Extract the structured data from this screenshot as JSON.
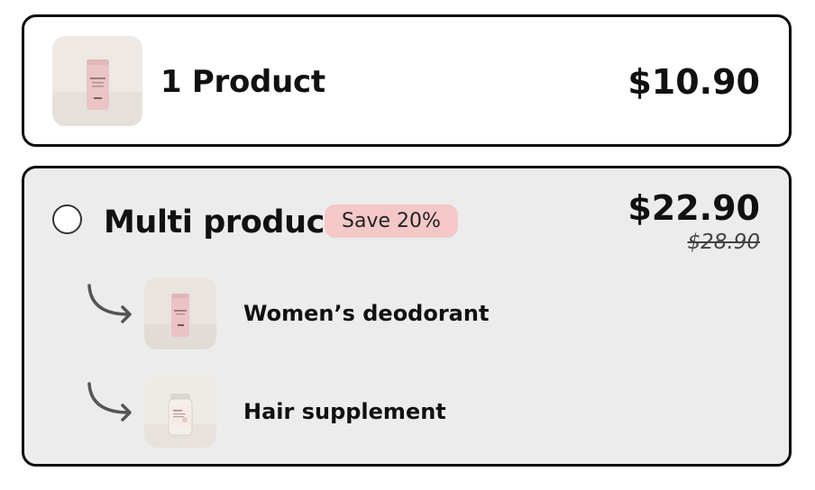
{
  "single_option": {
    "title": "1 Product",
    "price": "$10.90",
    "thumbnail_icon": "deodorant-stick-image"
  },
  "multi_option": {
    "title": "Multi product",
    "badge": "Save 20%",
    "price": "$22.90",
    "original_price": "$28.90",
    "items": [
      {
        "label": "Women’s deodorant",
        "thumbnail_icon": "deodorant-stick-image"
      },
      {
        "label": "Hair supplement",
        "thumbnail_icon": "supplement-bottle-image"
      }
    ]
  },
  "colors": {
    "border": "#0d0d0d",
    "multi_background": "#ececec",
    "badge_background": "#f5c8c8"
  }
}
